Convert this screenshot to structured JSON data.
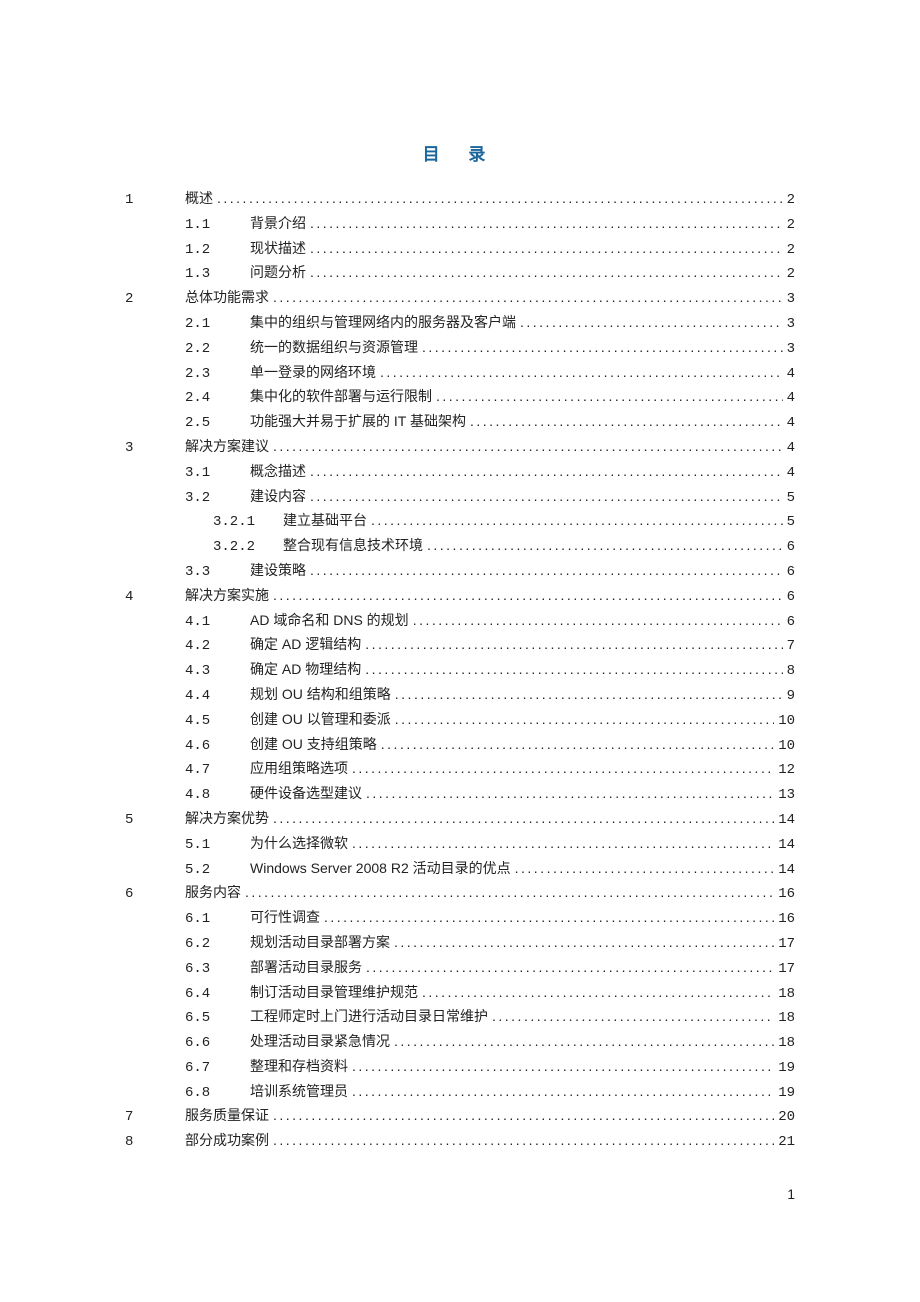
{
  "title": "目 录",
  "page_number": "1",
  "toc": [
    {
      "level": 0,
      "num": "1",
      "label": "概述",
      "page": "2"
    },
    {
      "level": 1,
      "num": "1.1",
      "label": "背景介绍",
      "page": "2"
    },
    {
      "level": 1,
      "num": "1.2",
      "label": "现状描述",
      "page": "2"
    },
    {
      "level": 1,
      "num": "1.3",
      "label": "问题分析",
      "page": "2"
    },
    {
      "level": 0,
      "num": "2",
      "label": "总体功能需求",
      "page": "3"
    },
    {
      "level": 1,
      "num": "2.1",
      "label": "集中的组织与管理网络内的服务器及客户端",
      "page": "3"
    },
    {
      "level": 1,
      "num": "2.2",
      "label": "统一的数据组织与资源管理",
      "page": "3"
    },
    {
      "level": 1,
      "num": "2.3",
      "label": "单一登录的网络环境",
      "page": "4"
    },
    {
      "level": 1,
      "num": "2.4",
      "label": "集中化的软件部署与运行限制",
      "page": "4"
    },
    {
      "level": 1,
      "num": "2.5",
      "label": "功能强大并易于扩展的 IT 基础架构",
      "page": "4"
    },
    {
      "level": 0,
      "num": "3",
      "label": "解决方案建议",
      "page": "4"
    },
    {
      "level": 1,
      "num": "3.1",
      "label": "概念描述",
      "page": "4"
    },
    {
      "level": 1,
      "num": "3.2",
      "label": "建设内容",
      "page": "5"
    },
    {
      "level": 2,
      "num": "3.2.1",
      "label": "建立基础平台",
      "page": "5"
    },
    {
      "level": 2,
      "num": "3.2.2",
      "label": "整合现有信息技术环境",
      "page": "6"
    },
    {
      "level": 1,
      "num": "3.3",
      "label": "建设策略",
      "page": "6"
    },
    {
      "level": 0,
      "num": "4",
      "label": "解决方案实施",
      "page": "6"
    },
    {
      "level": 1,
      "num": "4.1",
      "label": "AD 域命名和 DNS 的规划",
      "page": "6"
    },
    {
      "level": 1,
      "num": "4.2",
      "label": "确定 AD 逻辑结构",
      "page": "7"
    },
    {
      "level": 1,
      "num": "4.3",
      "label": "确定 AD 物理结构",
      "page": "8"
    },
    {
      "level": 1,
      "num": "4.4",
      "label": "规划 OU 结构和组策略",
      "page": "9"
    },
    {
      "level": 1,
      "num": "4.5",
      "label": "创建 OU 以管理和委派",
      "page": "10"
    },
    {
      "level": 1,
      "num": "4.6",
      "label": "创建 OU 支持组策略",
      "page": "10"
    },
    {
      "level": 1,
      "num": "4.7",
      "label": "应用组策略选项",
      "page": "12"
    },
    {
      "level": 1,
      "num": "4.8",
      "label": "硬件设备选型建议",
      "page": "13"
    },
    {
      "level": 0,
      "num": "5",
      "label": "解决方案优势",
      "page": "14"
    },
    {
      "level": 1,
      "num": "5.1",
      "label": "为什么选择微软",
      "page": "14"
    },
    {
      "level": 1,
      "num": "5.2",
      "label": "Windows Server 2008 R2 活动目录的优点",
      "page": "14"
    },
    {
      "level": 0,
      "num": "6",
      "label": "服务内容",
      "page": "16"
    },
    {
      "level": 1,
      "num": "6.1",
      "label": "可行性调查",
      "page": "16"
    },
    {
      "level": 1,
      "num": "6.2",
      "label": "规划活动目录部署方案",
      "page": "17"
    },
    {
      "level": 1,
      "num": "6.3",
      "label": "部署活动目录服务",
      "page": "17"
    },
    {
      "level": 1,
      "num": "6.4",
      "label": "制订活动目录管理维护规范",
      "page": "18"
    },
    {
      "level": 1,
      "num": "6.5",
      "label": "工程师定时上门进行活动目录日常维护",
      "page": "18"
    },
    {
      "level": 1,
      "num": "6.6",
      "label": "处理活动目录紧急情况",
      "page": "18"
    },
    {
      "level": 1,
      "num": "6.7",
      "label": "整理和存档资料",
      "page": "19"
    },
    {
      "level": 1,
      "num": "6.8",
      "label": "培训系统管理员",
      "page": "19"
    },
    {
      "level": 0,
      "num": "7",
      "label": "服务质量保证",
      "page": "20"
    },
    {
      "level": 0,
      "num": "8",
      "label": "部分成功案例",
      "page": "21"
    }
  ]
}
